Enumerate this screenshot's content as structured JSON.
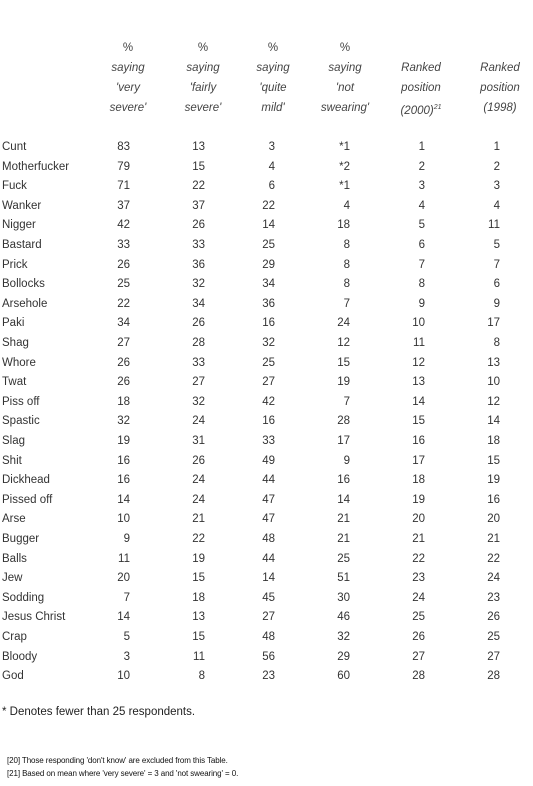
{
  "table": {
    "headers": [
      {
        "lines": [
          "%",
          "saying",
          "'very",
          "severe'"
        ]
      },
      {
        "lines": [
          "%",
          "saying",
          "'fairly",
          "severe'"
        ]
      },
      {
        "lines": [
          "%",
          "saying",
          "'quite",
          "mild'"
        ]
      },
      {
        "lines": [
          "%",
          "saying",
          "'not",
          "swearing'"
        ]
      },
      {
        "lines": [
          "",
          "Ranked",
          "position",
          "(2000)"
        ],
        "sup": "21"
      },
      {
        "lines": [
          "",
          "Ranked",
          "position",
          "(1998)"
        ]
      }
    ],
    "rows": [
      {
        "term": "Cunt",
        "values": [
          "83",
          "13",
          "3",
          "*1",
          "1",
          "1"
        ]
      },
      {
        "term": "Motherfucker",
        "values": [
          "79",
          "15",
          "4",
          "*2",
          "2",
          "2"
        ]
      },
      {
        "term": "Fuck",
        "values": [
          "71",
          "22",
          "6",
          "*1",
          "3",
          "3"
        ]
      },
      {
        "term": "Wanker",
        "values": [
          "37",
          "37",
          "22",
          "4",
          "4",
          "4"
        ]
      },
      {
        "term": "Nigger",
        "values": [
          "42",
          "26",
          "14",
          "18",
          "5",
          "11"
        ]
      },
      {
        "term": "Bastard",
        "values": [
          "33",
          "33",
          "25",
          "8",
          "6",
          "5"
        ]
      },
      {
        "term": "Prick",
        "values": [
          "26",
          "36",
          "29",
          "8",
          "7",
          "7"
        ]
      },
      {
        "term": "Bollocks",
        "values": [
          "25",
          "32",
          "34",
          "8",
          "8",
          "6"
        ]
      },
      {
        "term": "Arsehole",
        "values": [
          "22",
          "34",
          "36",
          "7",
          "9",
          "9"
        ]
      },
      {
        "term": "Paki",
        "values": [
          "34",
          "26",
          "16",
          "24",
          "10",
          "17"
        ]
      },
      {
        "term": "Shag",
        "values": [
          "27",
          "28",
          "32",
          "12",
          "11",
          "8"
        ]
      },
      {
        "term": "Whore",
        "values": [
          "26",
          "33",
          "25",
          "15",
          "12",
          "13"
        ]
      },
      {
        "term": "Twat",
        "values": [
          "26",
          "27",
          "27",
          "19",
          "13",
          "10"
        ]
      },
      {
        "term": "Piss off",
        "values": [
          "18",
          "32",
          "42",
          "7",
          "14",
          "12"
        ]
      },
      {
        "term": "Spastic",
        "values": [
          "32",
          "24",
          "16",
          "28",
          "15",
          "14"
        ]
      },
      {
        "term": "Slag",
        "values": [
          "19",
          "31",
          "33",
          "17",
          "16",
          "18"
        ]
      },
      {
        "term": "Shit",
        "values": [
          "16",
          "26",
          "49",
          "9",
          "17",
          "15"
        ]
      },
      {
        "term": "Dickhead",
        "values": [
          "16",
          "24",
          "44",
          "16",
          "18",
          "19"
        ]
      },
      {
        "term": "Pissed off",
        "values": [
          "14",
          "24",
          "47",
          "14",
          "19",
          "16"
        ]
      },
      {
        "term": "Arse",
        "values": [
          "10",
          "21",
          "47",
          "21",
          "20",
          "20"
        ]
      },
      {
        "term": "Bugger",
        "values": [
          "9",
          "22",
          "48",
          "21",
          "21",
          "21"
        ]
      },
      {
        "term": "Balls",
        "values": [
          "11",
          "19",
          "44",
          "25",
          "22",
          "22"
        ]
      },
      {
        "term": "Jew",
        "values": [
          "20",
          "15",
          "14",
          "51",
          "23",
          "24"
        ]
      },
      {
        "term": "Sodding",
        "values": [
          "7",
          "18",
          "45",
          "30",
          "24",
          "23"
        ]
      },
      {
        "term": "Jesus Christ",
        "values": [
          "14",
          "13",
          "27",
          "46",
          "25",
          "26"
        ]
      },
      {
        "term": "Crap",
        "values": [
          "5",
          "15",
          "48",
          "32",
          "26",
          "25"
        ]
      },
      {
        "term": "Bloody",
        "values": [
          "3",
          "11",
          "56",
          "29",
          "27",
          "27"
        ]
      },
      {
        "term": "God",
        "values": [
          "10",
          "8",
          "23",
          "60",
          "28",
          "28"
        ]
      }
    ]
  },
  "note": "* Denotes fewer than 25 respondents.",
  "footnotes": [
    "[20] Those responding 'don't know' are excluded from this Table.",
    "[21] Based on mean where 'very severe' = 3 and 'not swearing' = 0."
  ]
}
